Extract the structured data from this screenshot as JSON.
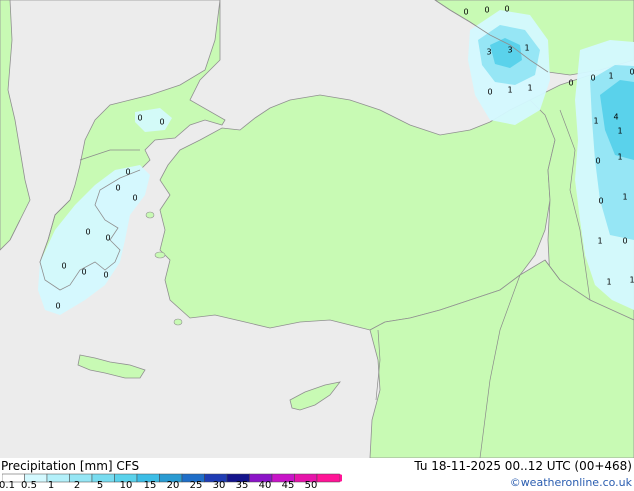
{
  "header": {
    "title": "Precipitation [mm]  CFS",
    "datetime": "Tu 18-11-2025 00..12 UTC (00+468)",
    "credit": "©weatheronline.co.uk"
  },
  "legend": {
    "ticks": [
      "0.1",
      "0.5",
      "1",
      "2",
      "5",
      "10",
      "15",
      "20",
      "25",
      "30",
      "35",
      "40",
      "45",
      "50"
    ],
    "colors": [
      "#ffffff",
      "#d4f9ff",
      "#b4f0fa",
      "#96e6f5",
      "#78dcf0",
      "#5ad2eb",
      "#3cbde6",
      "#2a9bd2",
      "#1f6ec8",
      "#1f3cb4",
      "#14148c",
      "#8c14c8",
      "#c814c8",
      "#e614aa",
      "#ff1496"
    ]
  },
  "map": {
    "colors": {
      "land": "#c8fab4",
      "sea": "#ececec",
      "coast": "#909090",
      "border": "#8a8a8a",
      "precip_light": "#d4f9ff",
      "precip_mid": "#96e6f5",
      "precip_high": "#5ad2eb"
    },
    "labels": [
      "0",
      "0",
      "0",
      "3",
      "3",
      "1",
      "0",
      "1",
      "1",
      "0",
      "0",
      "1",
      "0",
      "1",
      "4",
      "1",
      "0",
      "1",
      "0",
      "1",
      "1",
      "0",
      "1",
      "1",
      "0",
      "0",
      "0",
      "0",
      "0",
      "0",
      "0",
      "0",
      "0",
      "0",
      "0"
    ]
  }
}
